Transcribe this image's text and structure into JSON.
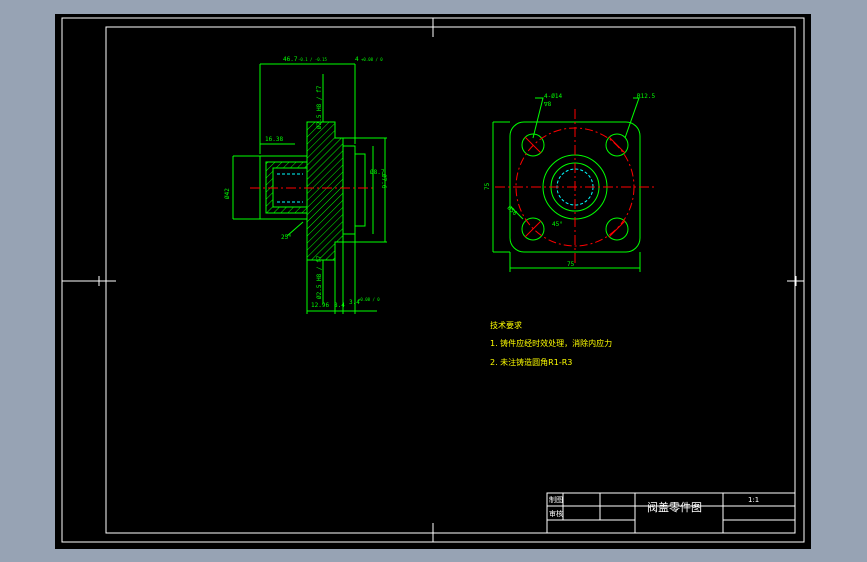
{
  "colors": {
    "background": "#97a3b4",
    "canvas": "#000000",
    "frame": "#ffffff",
    "geometry": "#00ff00",
    "dimension": "#00ff00",
    "center_line": "#ff0000",
    "hatch": "#00ff00",
    "hidden": "#00ffff",
    "text": "#ffff00"
  },
  "section_view": {
    "dims": {
      "top_overall": "46.7",
      "top_overall_tol": "-0.1 / -0.15",
      "top_right": "4",
      "top_right_tol": "+0.08 / 0",
      "left_width": "16.38",
      "left_dia": "Ø42",
      "bottom_left": "12.96",
      "bottom_mid": "8.4",
      "bottom_right": "3.4",
      "bottom_right_tol": "+0.08 / 0",
      "right_dia_1": "Ø8.7",
      "right_dia_2": "Ø7.6",
      "vert_top": "Ø2.5 H8 / f7",
      "vert_bottom": "Ø2.5 H8 / f7",
      "angle": "25°"
    }
  },
  "plan_view": {
    "labels": {
      "holes": "4-Ø14",
      "hole_depth": "∇8",
      "radius": "R12.5",
      "width": "75",
      "height": "75",
      "bolt_circle": "Ø56",
      "angle": "45°"
    }
  },
  "tech_requirements": {
    "title": "技术要求",
    "items": [
      "1. 铸件应经时效处理，消除内应力",
      "2. 未注铸造圆角R1-R3"
    ]
  },
  "title_block": {
    "part_name": "阀盖零件图",
    "scale": "1:1",
    "row1_label": "制图",
    "row2_label": "审核"
  }
}
